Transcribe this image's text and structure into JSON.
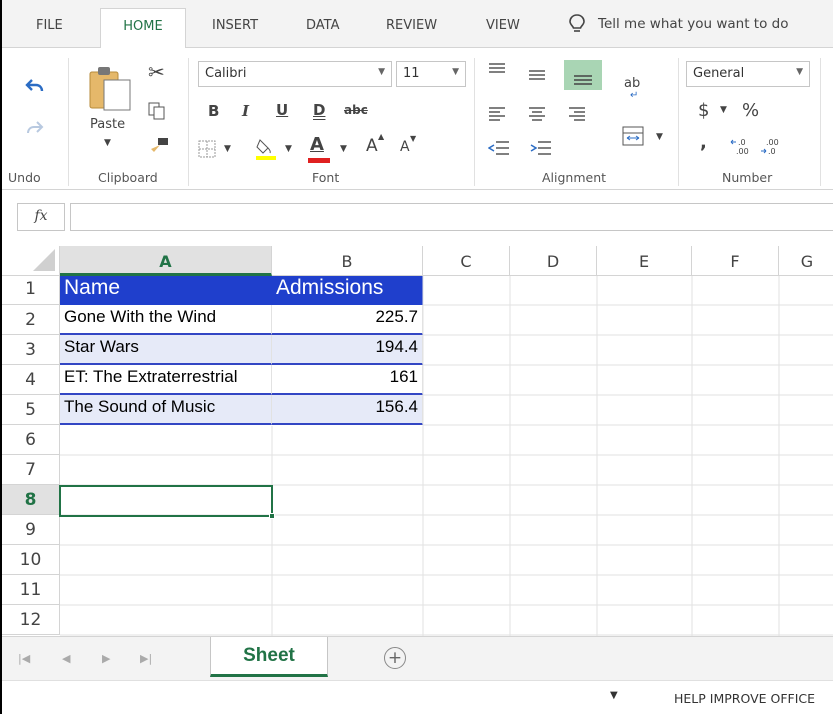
{
  "tabs": [
    "FILE",
    "HOME",
    "INSERT",
    "DATA",
    "REVIEW",
    "VIEW"
  ],
  "tell_me": "Tell me what you want to do",
  "ribbon": {
    "undo_label": "Undo",
    "clipboard_label": "Clipboard",
    "font_label": "Font",
    "alignment_label": "Alignment",
    "number_label": "Number",
    "paste_label": "Paste",
    "font_name": "Calibri",
    "font_size": "11",
    "number_format": "General",
    "bold": "B",
    "italic": "I",
    "underline": "U",
    "double_underline": "D",
    "strike": "abc",
    "font_color_letter": "A",
    "grow_font": "A",
    "shrink_font": "A",
    "currency": "$",
    "percent": "%",
    "comma": ",",
    "wrap_text": "ab",
    "accent_colors": {
      "highlight": "#ffff00",
      "font_color": "#ff0000",
      "selected_align": "#a9d5b4"
    }
  },
  "formula_bar": {
    "fx": "fx",
    "value": ""
  },
  "columns": [
    "A",
    "B",
    "C",
    "D",
    "E",
    "F",
    "G"
  ],
  "rows": [
    "1",
    "2",
    "3",
    "4",
    "5",
    "6",
    "7",
    "8",
    "9",
    "10",
    "11",
    "12"
  ],
  "selected_cell": "A8",
  "table": {
    "header": [
      "Name",
      "Admissions"
    ],
    "data": [
      [
        "Gone With the Wind",
        "225.7"
      ],
      [
        "Star Wars",
        "194.4"
      ],
      [
        "ET: The Extraterrestrial",
        "161"
      ],
      [
        "The Sound of Music",
        "156.4"
      ]
    ],
    "header_color": "#1f3fcc",
    "band_color": "#e6eaf8"
  },
  "sheet_tab": "Sheet",
  "status": {
    "help_text": "HELP IMPROVE OFFICE"
  }
}
